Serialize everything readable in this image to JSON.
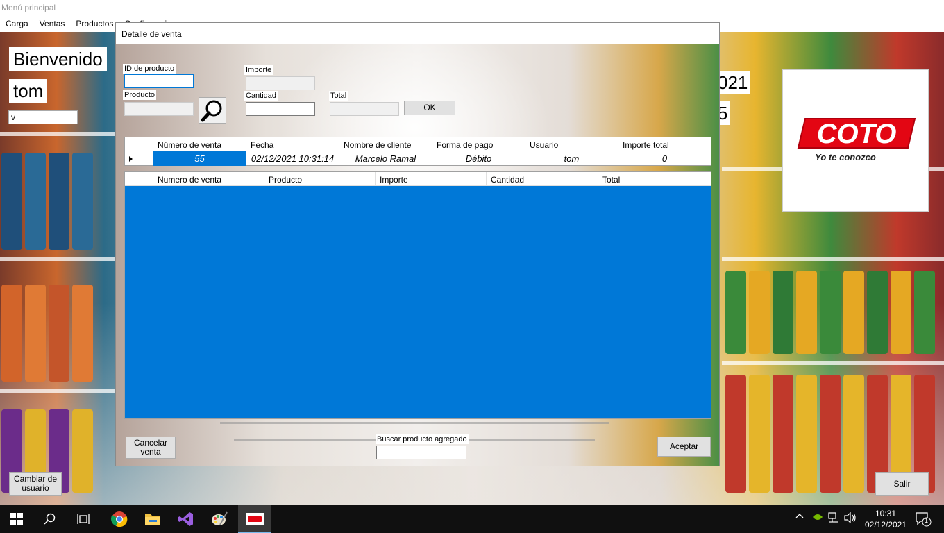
{
  "main_window": {
    "title": "Menú principal",
    "menu": [
      "Carga",
      "Ventas",
      "Productos",
      "Configuracion"
    ],
    "welcome_label": "Bienvenido",
    "user_label": "tom",
    "side_input_value": "v",
    "right_label_1": "021",
    "right_label_2": "5",
    "logo_text": "COTO",
    "logo_slogan": "Yo te conozco",
    "change_user_label": "Cambiar de usuario",
    "exit_label": "Salir"
  },
  "dialog": {
    "title": "Detalle de venta",
    "fields": {
      "product_id_label": "ID de producto",
      "product_label": "Producto",
      "price_label": "Importe",
      "quantity_label": "Cantidad",
      "total_label": "Total"
    },
    "ok_label": "OK",
    "sale_grid": {
      "columns": [
        "Número de venta",
        "Fecha",
        "Nombre de cliente",
        "Forma de pago",
        "Usuario",
        "Importe total"
      ],
      "row": [
        "55",
        "02/12/2021 10:31:14",
        "Marcelo Ramal",
        "Débito",
        "tom",
        "0"
      ]
    },
    "items_grid": {
      "columns": [
        "Numero de venta",
        "Producto",
        "Importe",
        "Cantidad",
        "Total"
      ]
    },
    "cancel_label": "Cancelar venta",
    "search_added_label": "Buscar producto agregado",
    "accept_label": "Aceptar"
  },
  "taskbar": {
    "time": "10:31",
    "date": "02/12/2021",
    "notification_count": "1",
    "colors": {
      "background": "#101010",
      "accent": "#0078d7"
    }
  }
}
